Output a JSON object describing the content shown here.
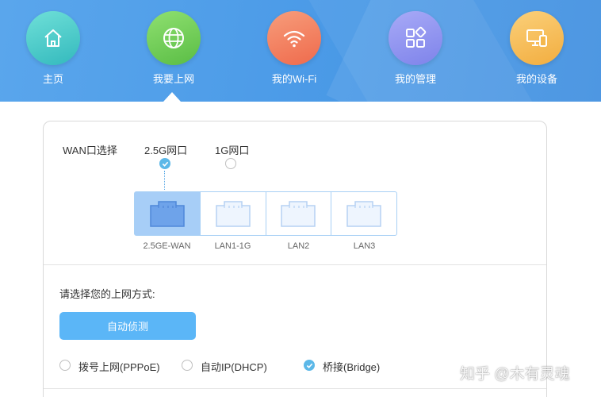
{
  "nav": {
    "items": [
      {
        "label": "主页",
        "icon": "home-icon",
        "color": "#3ec6c4"
      },
      {
        "label": "我要上网",
        "icon": "globe-icon",
        "color": "#74cf5a"
      },
      {
        "label": "我的Wi-Fi",
        "icon": "wifi-icon",
        "color": "#f27b5c"
      },
      {
        "label": "我的管理",
        "icon": "apps-icon",
        "color": "#8b8ff0"
      },
      {
        "label": "我的设备",
        "icon": "device-icon",
        "color": "#f7c057"
      }
    ],
    "active_index": 1
  },
  "wan": {
    "label": "WAN口选择",
    "options": [
      {
        "label": "2.5G网口",
        "checked": true
      },
      {
        "label": "1G网口",
        "checked": false
      }
    ],
    "ports": [
      {
        "label": "2.5GE-WAN",
        "active": true
      },
      {
        "label": "LAN1-1G",
        "active": false
      },
      {
        "label": "LAN2",
        "active": false
      },
      {
        "label": "LAN3",
        "active": false
      }
    ]
  },
  "method": {
    "title": "请选择您的上网方式:",
    "detect_button": "自动侦测",
    "modes": [
      {
        "label": "拨号上网(PPPoE)",
        "checked": false
      },
      {
        "label": "自动IP(DHCP)",
        "checked": false
      },
      {
        "label": "桥接(Bridge)",
        "checked": true
      }
    ]
  },
  "watermark": "知乎 @木有灵魂"
}
